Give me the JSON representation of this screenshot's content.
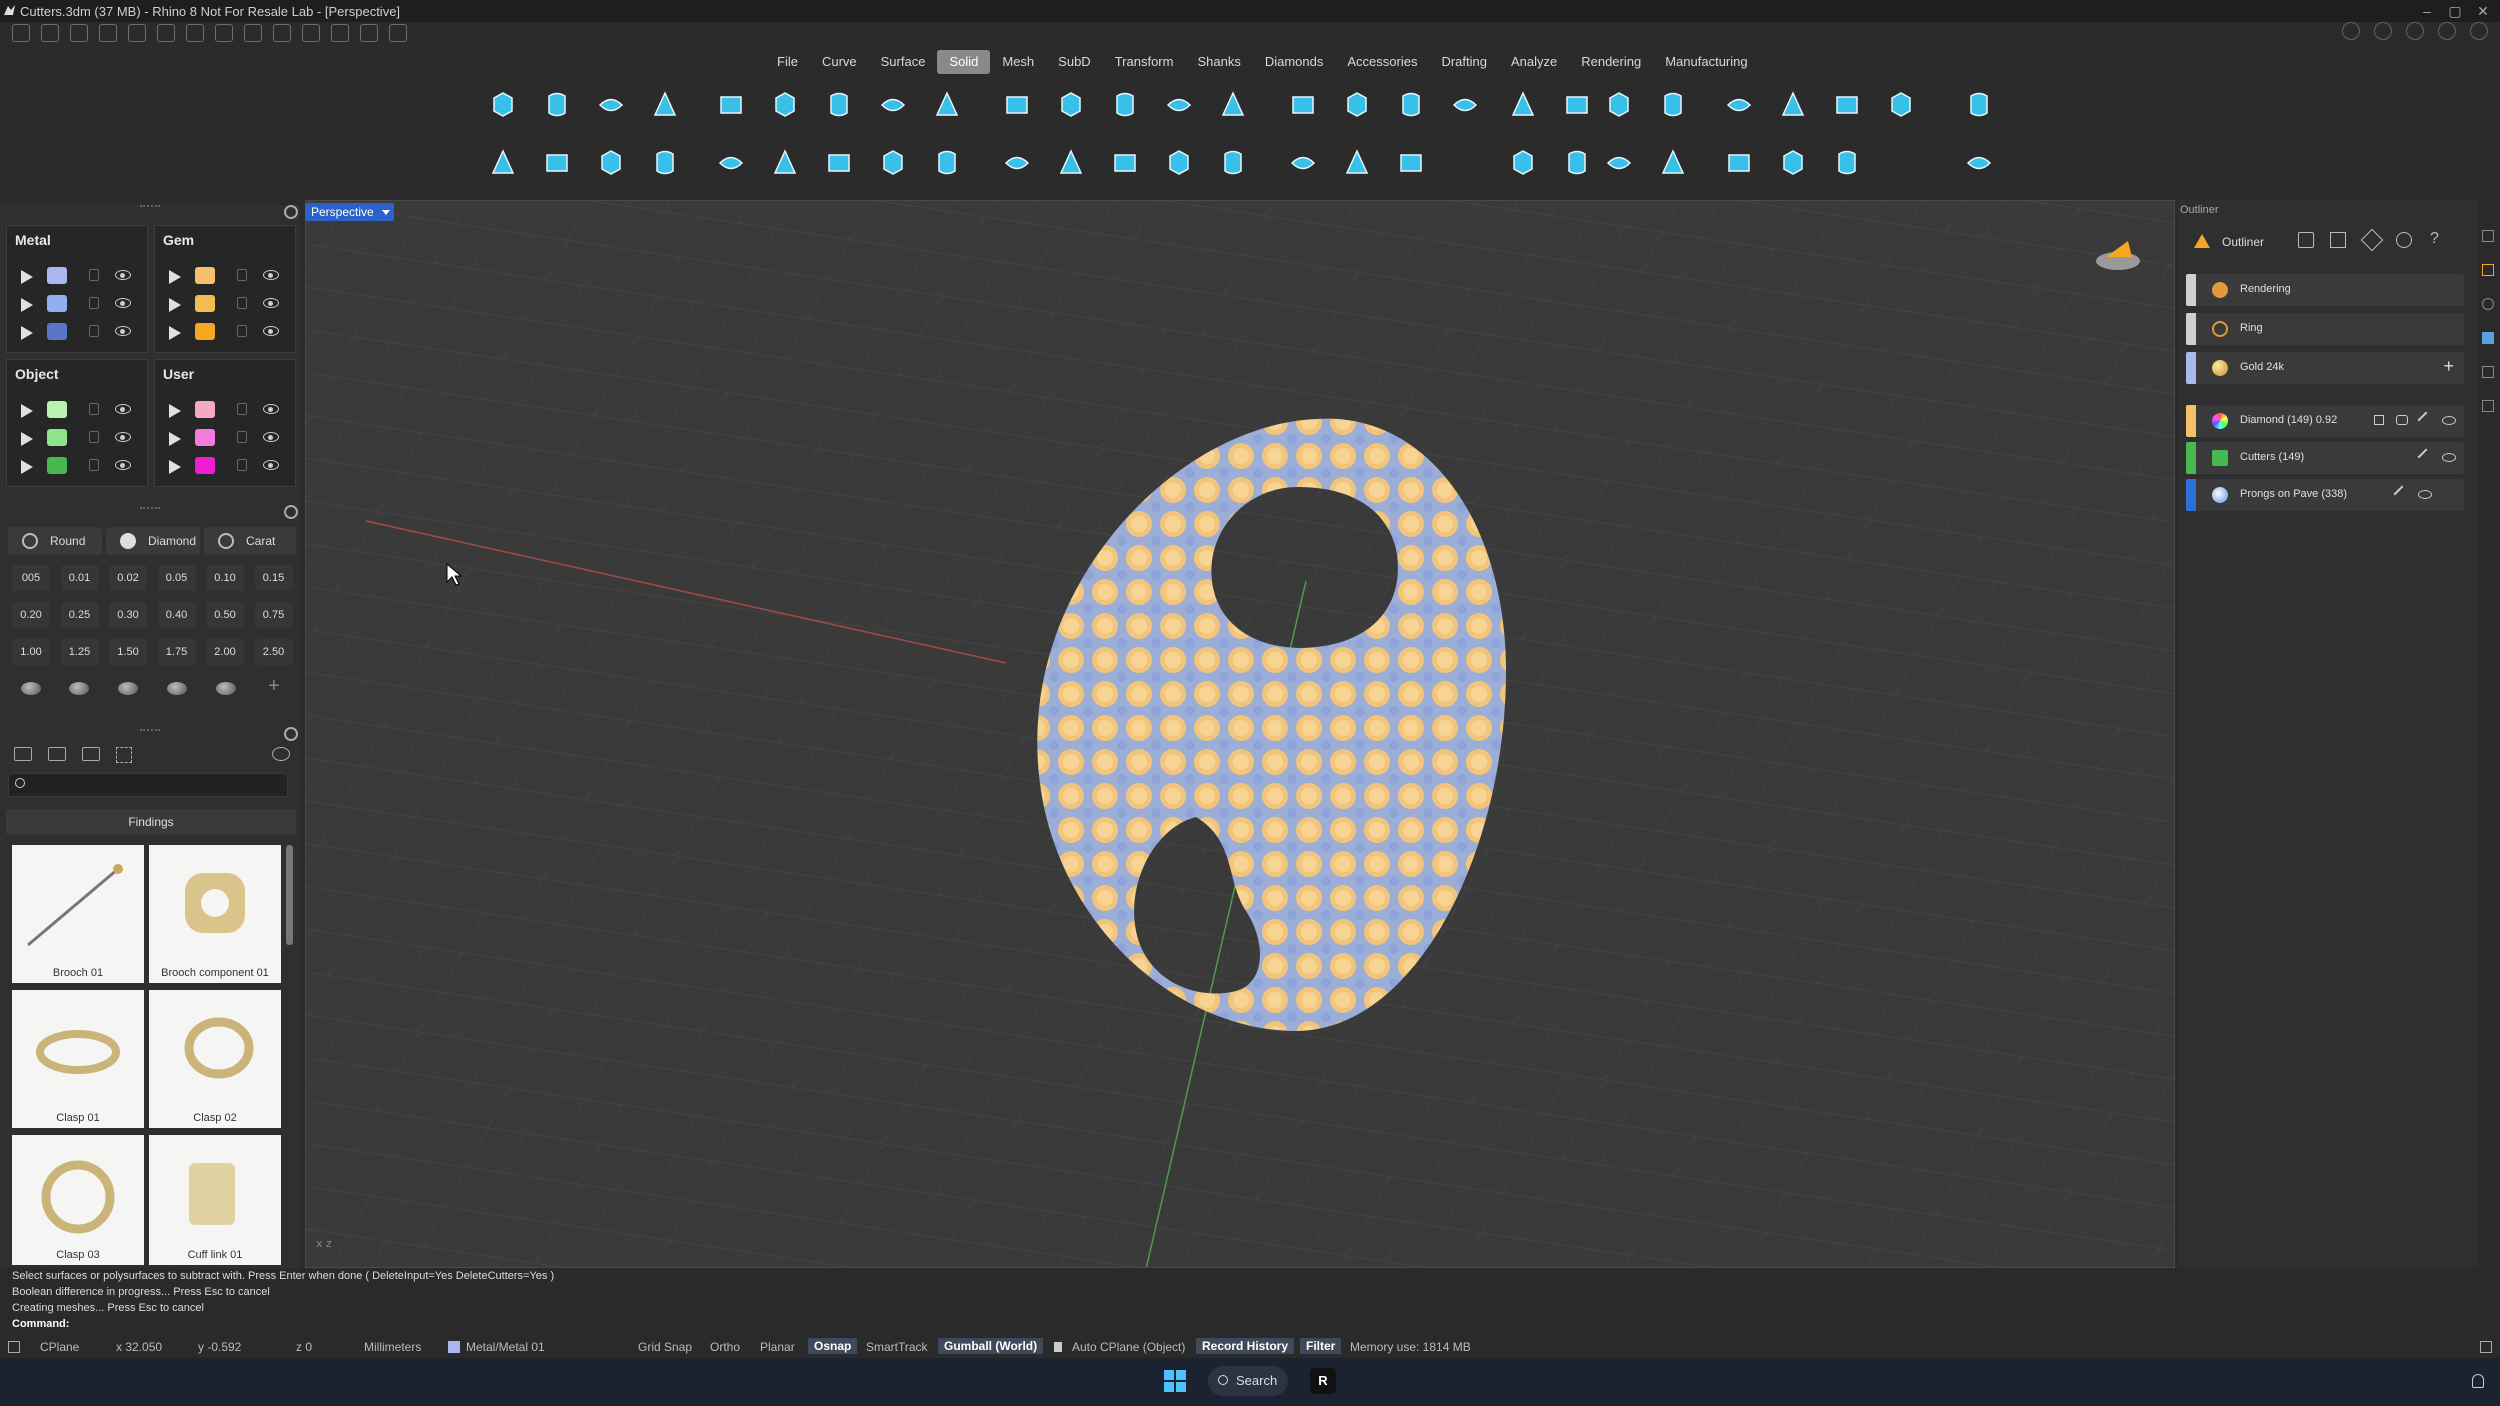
{
  "window": {
    "title": "Cutters.3dm (37 MB) - Rhino 8 Not For Resale Lab - [Perspective]"
  },
  "menu": {
    "items": [
      "File",
      "Curve",
      "Surface",
      "Solid",
      "Mesh",
      "SubD",
      "Transform",
      "Shanks",
      "Diamonds",
      "Accessories",
      "Drafting",
      "Analyze",
      "Rendering",
      "Manufacturing"
    ],
    "active": "Solid"
  },
  "layers": {
    "metal": {
      "title": "Metal",
      "colors": [
        "#a9b8ee",
        "#94aef2",
        "#5877c8"
      ]
    },
    "gem": {
      "title": "Gem",
      "colors": [
        "#f4c16a",
        "#f2bb55",
        "#f5a623"
      ]
    },
    "object": {
      "title": "Object",
      "colors": [
        "#b9f2b0",
        "#8fe38a",
        "#49b94f"
      ]
    },
    "user": {
      "title": "User",
      "colors": [
        "#f3a8c3",
        "#f27bdc",
        "#ee1cd3"
      ]
    }
  },
  "gems": {
    "filters": [
      "Round",
      "Diamond",
      "Carat"
    ],
    "sizes": [
      "005",
      "0.01",
      "0.02",
      "0.05",
      "0.10",
      "0.15",
      "0.20",
      "0.25",
      "0.30",
      "0.40",
      "0.50",
      "0.75",
      "1.00",
      "1.25",
      "1.50",
      "1.75",
      "2.00",
      "2.50"
    ]
  },
  "library": {
    "category": "Findings",
    "items": [
      "Brooch 01",
      "Brooch component 01",
      "Clasp 01",
      "Clasp 02",
      "Clasp 03",
      "Cuff link 01"
    ]
  },
  "viewport": {
    "label": "Perspective"
  },
  "outliner": {
    "title": "Outliner",
    "tab": "Outliner",
    "materials": [
      {
        "label": "Rendering",
        "color": "#cfcfcf"
      },
      {
        "label": "Ring",
        "color": "#cfcfcf"
      },
      {
        "label": "Gold 24k",
        "color": "#a9b8ee"
      }
    ],
    "objects": [
      {
        "label": "Diamond (149) 0.92",
        "color": "#f4c16a"
      },
      {
        "label": "Cutters (149)",
        "color": "#49b94f"
      },
      {
        "label": "Prongs on Pave (338)",
        "color": "#2f6fd8"
      }
    ]
  },
  "command": {
    "history": [
      "Select surfaces or polysurfaces to subtract with. Press Enter when done ( DeleteInput=Yes  DeleteCutters=Yes )",
      "Boolean difference in progress... Press Esc to cancel",
      "Creating meshes... Press Esc to cancel"
    ],
    "prompt": "Command:"
  },
  "status": {
    "cplane": "CPlane",
    "x": "x 32.050",
    "y": "y -0.592",
    "z": "z 0",
    "units": "Millimeters",
    "layer": "Metal/Metal 01",
    "grid_snap": "Grid Snap",
    "ortho": "Ortho",
    "planar": "Planar",
    "osnap": "Osnap",
    "smarttrack": "SmartTrack",
    "gumball": "Gumball (World)",
    "auto_cplane": "Auto CPlane (Object)",
    "record_history": "Record History",
    "filter": "Filter",
    "memory": "Memory use: 1814 MB"
  },
  "taskbar": {
    "search": "Search"
  }
}
